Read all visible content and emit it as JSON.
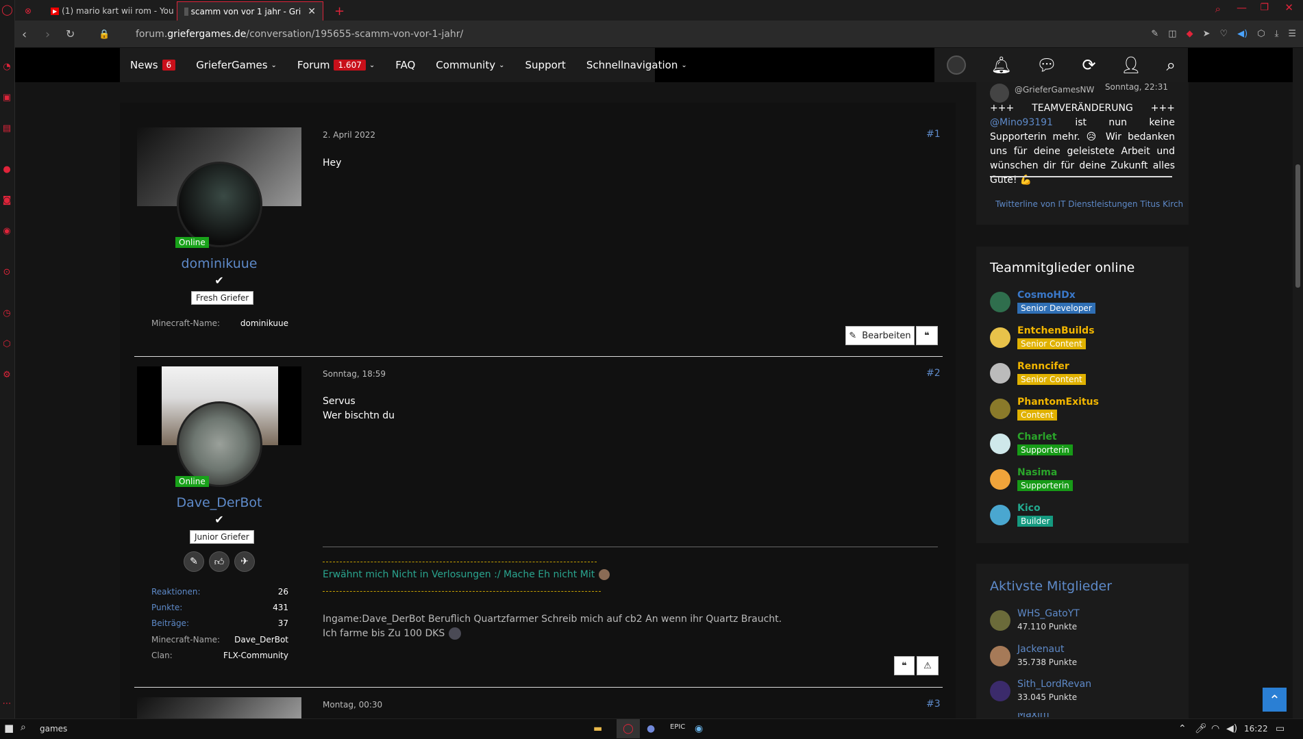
{
  "browser": {
    "tabs": [
      {
        "title": ""
      },
      {
        "title": "(1) mario kart wii rom - You"
      },
      {
        "title": "scamm von vor 1 jahr - Gri"
      }
    ],
    "url_prefix": "forum.",
    "url_domain": "griefergames.de",
    "url_path": "/conversation/195655-scamm-von-vor-1-jahr/"
  },
  "nav": {
    "items": [
      {
        "label": "News",
        "badge": "6"
      },
      {
        "label": "GrieferGames",
        "dropdown": true
      },
      {
        "label": "Forum",
        "badge": "1.607",
        "dropdown": true
      },
      {
        "label": "FAQ"
      },
      {
        "label": "Community",
        "dropdown": true
      },
      {
        "label": "Support"
      },
      {
        "label": "Schnellnavigation",
        "dropdown": true
      }
    ]
  },
  "posts": [
    {
      "author": "dominikuue",
      "status": "Online",
      "rank": "Fresh Griefer",
      "meta": [
        {
          "label": "Minecraft-Name:",
          "value": "dominikuue"
        }
      ],
      "date": "2. April 2022",
      "number": "#1",
      "text": [
        "Hey"
      ],
      "edit_label": "Bearbeiten"
    },
    {
      "author": "Dave_DerBot",
      "status": "Online",
      "rank": "Junior Griefer",
      "meta": [
        {
          "label": "Reaktionen:",
          "value": "26"
        },
        {
          "label": "Punkte:",
          "value": "431"
        },
        {
          "label": "Beiträge:",
          "value": "37"
        },
        {
          "label": "Minecraft-Name:",
          "value": "Dave_DerBot"
        },
        {
          "label": "Clan:",
          "value": "FLX-Community"
        }
      ],
      "date": "Sonntag, 18:59",
      "number": "#2",
      "text": [
        "Servus",
        "Wer bischtn du"
      ],
      "signature_link": "Erwähnt mich Nicht in Verlosungen :/ Mache Eh nicht Mit",
      "signature_text": [
        "Ingame:Dave_DerBot Beruflich Quartzfarmer Schreib mich auf cb2 An wenn ihr Quartz Braucht.",
        "Ich farme bis Zu 100 DKS"
      ]
    },
    {
      "date": "Montag, 00:30",
      "number": "#3"
    }
  ],
  "twitter": {
    "handle": "@GrieferGamesNW",
    "time": "Sonntag, 22:31",
    "plus": "+++",
    "title": "TEAMVERÄNDERUNG",
    "mention": "@Mino93191",
    "body": "ist nun keine Supporterin mehr. 😥 Wir bedanken uns für deine geleistete Arbeit und wünschen dir für deine Zukunft alles Gute! 💪",
    "footer": "Twitterline von IT Dienstleistungen Titus Kirch"
  },
  "team": {
    "title": "Teammitglieder online",
    "members": [
      {
        "name": "CosmoHDx",
        "role": "Senior Developer",
        "name_color": "#3a78c9",
        "role_bg": "#2f6fb5"
      },
      {
        "name": "EntchenBuilds",
        "role": "Senior Content",
        "name_color": "#f2b600",
        "role_bg": "#e0b100"
      },
      {
        "name": "Renncifer",
        "role": "Senior Content",
        "name_color": "#f2b600",
        "role_bg": "#e0b100"
      },
      {
        "name": "PhantomExitus",
        "role": "Content",
        "name_color": "#f2b600",
        "role_bg": "#e0b100"
      },
      {
        "name": "Charlet",
        "role": "Supporterin",
        "name_color": "#2aa52a",
        "role_bg": "#179b17"
      },
      {
        "name": "Nasima",
        "role": "Supporterin",
        "name_color": "#2aa52a",
        "role_bg": "#179b17"
      },
      {
        "name": "Kico",
        "role": "Builder",
        "name_color": "#23a98f",
        "role_bg": "#159a80"
      }
    ]
  },
  "active": {
    "title": "Aktivste Mitglieder",
    "members": [
      {
        "name": "WHS_GatoYT",
        "points": "47.110 Punkte"
      },
      {
        "name": "Jackenaut",
        "points": "35.738 Punkte"
      },
      {
        "name": "Sith_LordRevan",
        "points": "33.045 Punkte"
      },
      {
        "name": "Maxim"
      }
    ]
  },
  "taskbar": {
    "search": "games",
    "time": "16:22"
  }
}
